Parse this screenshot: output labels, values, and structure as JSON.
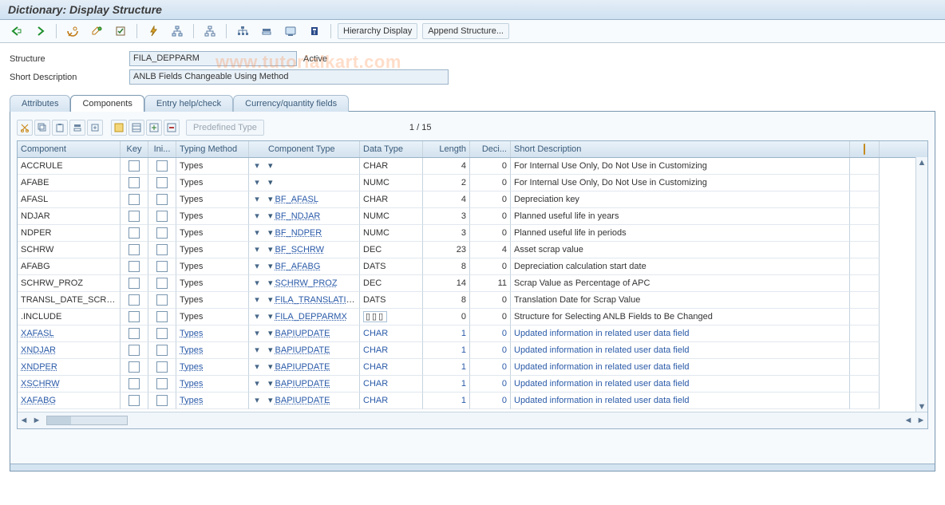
{
  "header": {
    "title": "Dictionary: Display Structure"
  },
  "toolbar": {
    "back_icon": "back",
    "forward_icon": "forward",
    "buttons": {
      "hierarchy_display": "Hierarchy Display",
      "append_structure": "Append Structure..."
    }
  },
  "watermark": "www.tutorialkart.com",
  "form": {
    "structure_label": "Structure",
    "structure_value": "FILA_DEPPARM",
    "status": "Active",
    "short_desc_label": "Short Description",
    "short_desc_value": "ANLB Fields Changeable Using Method"
  },
  "tabs": {
    "attributes": "Attributes",
    "components": "Components",
    "entry_help": "Entry help/check",
    "currency_qty": "Currency/quantity fields"
  },
  "mini_toolbar": {
    "predefined_type": "Predefined Type"
  },
  "counter": {
    "current": 1,
    "sep": " / ",
    "total": 15
  },
  "columns": {
    "component": "Component",
    "key": "Key",
    "ini": "Ini...",
    "typing": "Typing Method",
    "comptype": "Component Type",
    "dtype": "Data Type",
    "length": "Length",
    "deci": "Deci...",
    "desc": "Short Description"
  },
  "rows": [
    {
      "component": "ACCRULE",
      "typing": "Types",
      "comptype": "",
      "dtype": "CHAR",
      "len": "4",
      "dec": "0",
      "desc": "For Internal Use Only, Do Not Use in Customizing",
      "blue": false
    },
    {
      "component": "AFABE",
      "typing": "Types",
      "comptype": "",
      "dtype": "NUMC",
      "len": "2",
      "dec": "0",
      "desc": "For Internal Use Only, Do Not Use in Customizing",
      "blue": false
    },
    {
      "component": "AFASL",
      "typing": "Types",
      "comptype": "BF_AFASL",
      "dtype": "CHAR",
      "len": "4",
      "dec": "0",
      "desc": "Depreciation key",
      "blue": false
    },
    {
      "component": "NDJAR",
      "typing": "Types",
      "comptype": "BF_NDJAR",
      "dtype": "NUMC",
      "len": "3",
      "dec": "0",
      "desc": "Planned useful life in years",
      "blue": false
    },
    {
      "component": "NDPER",
      "typing": "Types",
      "comptype": "BF_NDPER",
      "dtype": "NUMC",
      "len": "3",
      "dec": "0",
      "desc": "Planned useful life in periods",
      "blue": false
    },
    {
      "component": "SCHRW",
      "typing": "Types",
      "comptype": "BF_SCHRW",
      "dtype": "DEC",
      "len": "23",
      "dec": "4",
      "desc": "Asset scrap value",
      "blue": false
    },
    {
      "component": "AFABG",
      "typing": "Types",
      "comptype": "BF_AFABG",
      "dtype": "DATS",
      "len": "8",
      "dec": "0",
      "desc": "Depreciation calculation start date",
      "blue": false
    },
    {
      "component": "SCHRW_PROZ",
      "typing": "Types",
      "comptype": "SCHRW_PROZ",
      "dtype": "DEC",
      "len": "14",
      "dec": "11",
      "desc": "Scrap Value as Percentage of APC",
      "blue": false
    },
    {
      "component": "TRANSL_DATE_SCR…",
      "typing": "Types",
      "comptype": "FILA_TRANSLATIO…",
      "dtype": "DATS",
      "len": "8",
      "dec": "0",
      "desc": "Translation Date for Scrap Value",
      "blue": false
    },
    {
      "component": ".INCLUDE",
      "typing": "Types",
      "comptype": "FILA_DEPPARMX",
      "dtype": "▫▫▫",
      "len": "0",
      "dec": "0",
      "desc": "Structure for Selecting ANLB Fields to Be Changed",
      "blue": false,
      "dtype_boxed": true
    },
    {
      "component": "XAFASL",
      "typing": "Types",
      "comptype": "BAPIUPDATE",
      "dtype": "CHAR",
      "len": "1",
      "dec": "0",
      "desc": "Updated information in related user data field",
      "blue": true
    },
    {
      "component": "XNDJAR",
      "typing": "Types",
      "comptype": "BAPIUPDATE",
      "dtype": "CHAR",
      "len": "1",
      "dec": "0",
      "desc": "Updated information in related user data field",
      "blue": true
    },
    {
      "component": "XNDPER",
      "typing": "Types",
      "comptype": "BAPIUPDATE",
      "dtype": "CHAR",
      "len": "1",
      "dec": "0",
      "desc": "Updated information in related user data field",
      "blue": true
    },
    {
      "component": "XSCHRW",
      "typing": "Types",
      "comptype": "BAPIUPDATE",
      "dtype": "CHAR",
      "len": "1",
      "dec": "0",
      "desc": "Updated information in related user data field",
      "blue": true
    },
    {
      "component": "XAFABG",
      "typing": "Types",
      "comptype": "BAPIUPDATE",
      "dtype": "CHAR",
      "len": "1",
      "dec": "0",
      "desc": "Updated information in related user data field",
      "blue": true
    }
  ]
}
